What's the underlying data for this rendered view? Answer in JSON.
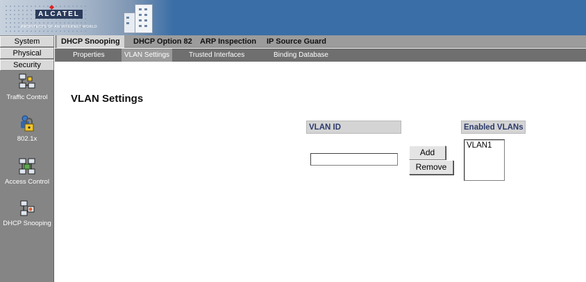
{
  "banner": {
    "logo_text": "ALCATEL",
    "tagline": "ARCHITECTS OF AN INTERNET WORLD"
  },
  "sidebar": {
    "buttons": [
      {
        "label": "System"
      },
      {
        "label": "Physical"
      },
      {
        "label": "Security"
      }
    ],
    "icons": [
      {
        "label": "Traffic Control",
        "icon": "network-lock-icon"
      },
      {
        "label": "802.1x",
        "icon": "user-lock-icon"
      },
      {
        "label": "Access Control",
        "icon": "network-acl-icon"
      },
      {
        "label": "DHCP Snooping",
        "icon": "dhcp-snooping-icon"
      }
    ]
  },
  "tabs": [
    {
      "label": "DHCP Snooping",
      "active": true
    },
    {
      "label": "DHCP Option 82",
      "active": false
    },
    {
      "label": "ARP Inspection",
      "active": false
    },
    {
      "label": "IP Source Guard",
      "active": false
    }
  ],
  "subtabs": [
    {
      "label": "Properties",
      "active": false
    },
    {
      "label": "VLAN Settings",
      "active": true
    },
    {
      "label": "Trusted Interfaces",
      "active": false
    },
    {
      "label": "Binding Database",
      "active": false
    }
  ],
  "main": {
    "title": "VLAN Settings",
    "vlan_id_header": "VLAN ID",
    "vlan_id_value": "",
    "enabled_header": "Enabled VLANs",
    "enabled_vlans": [
      "VLAN1"
    ],
    "add_label": "Add",
    "remove_label": "Remove"
  },
  "colors": {
    "banner": "#3a6ea6",
    "sidebar": "#858585",
    "header_text": "#2c3a6c"
  }
}
